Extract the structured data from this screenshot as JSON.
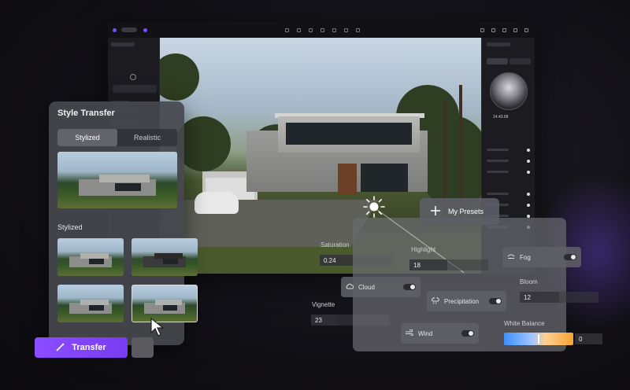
{
  "style_panel": {
    "title": "Style Transfer",
    "tabs": [
      "Stylized",
      "Realistic"
    ],
    "section_label": "Stylized"
  },
  "transfer_button": {
    "label": "Transfer"
  },
  "presets_button": {
    "label": "My Presets"
  },
  "controls": {
    "saturation": {
      "label": "Saturation",
      "value": "0.24"
    },
    "vignette": {
      "label": "Vignette",
      "value": "23"
    },
    "highlight": {
      "label": "Highlight",
      "value": "18"
    },
    "bloom": {
      "label": "Bloom",
      "value": "12"
    },
    "white_balance": {
      "label": "White Balance",
      "value": "0"
    }
  },
  "toggles": {
    "fog": "Fog",
    "cloud": "Cloud",
    "precipitation": "Precipitation",
    "wind": "Wind"
  },
  "right_panel": {
    "dial_value": "14.43.68"
  },
  "colors": {
    "accent": "#8b4dff",
    "panel": "#46464e"
  }
}
